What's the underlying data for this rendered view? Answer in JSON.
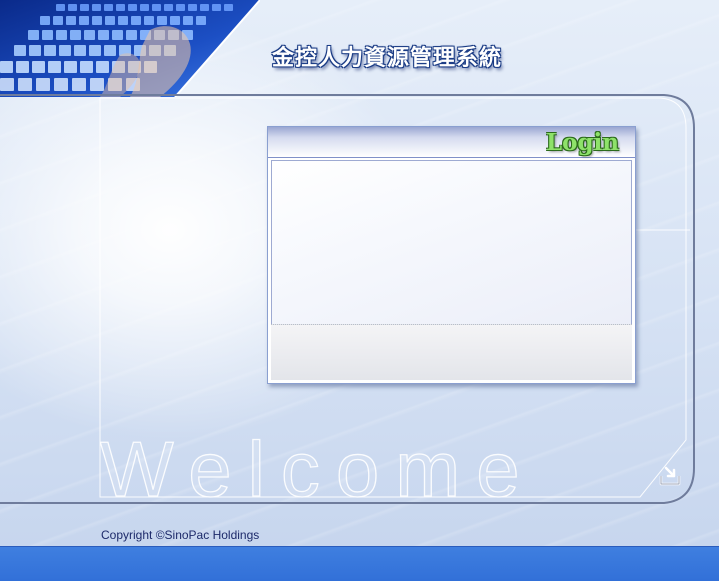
{
  "header": {
    "system_title": "金控人力資源管理系統"
  },
  "login": {
    "label": "Login"
  },
  "background": {
    "welcome_text": "Welcome"
  },
  "footer": {
    "copyright": "Copyright ©SinoPac Holdings"
  },
  "icons": {
    "exit": "exit-arrow-icon",
    "keyboard": "keyboard-photo"
  },
  "colors": {
    "bottom_bar": "#3a76dc",
    "title_outline": "#1c3d86",
    "login_label": "#8ee26a"
  }
}
